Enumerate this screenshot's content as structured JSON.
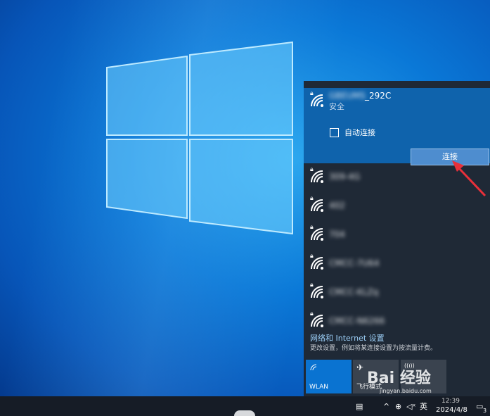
{
  "selected_network": {
    "name_visible_suffix": "_292C",
    "name_hidden": "GBEUMS",
    "security": "安全",
    "auto_connect_label": "自动连接",
    "connect_label": "连接"
  },
  "networks": [
    {
      "name": "309-4G"
    },
    {
      "name": "402"
    },
    {
      "name": "704"
    },
    {
      "name": "CMCC-7U64"
    },
    {
      "name": "CMCC-KLZq"
    },
    {
      "name": "CMCC-N6266"
    }
  ],
  "settings": {
    "title": "网络和 Internet 设置",
    "description": "更改设置，例如将某连接设置为按流量计费。"
  },
  "quick_actions": [
    {
      "label": "WLAN",
      "state": "on"
    },
    {
      "label": "飞行模式",
      "state": "off"
    },
    {
      "label": "",
      "state": "off"
    }
  ],
  "taskbar": {
    "ime": "英",
    "time": "12:39",
    "date": "2024/4/8",
    "notification_count": "3"
  },
  "watermark": {
    "text": "Bai 经验",
    "sub": "jingyan.baidu.com"
  },
  "colors": {
    "accent": "#0f63ac",
    "tile_on": "#0a73d1",
    "arrow": "#e8303a"
  }
}
